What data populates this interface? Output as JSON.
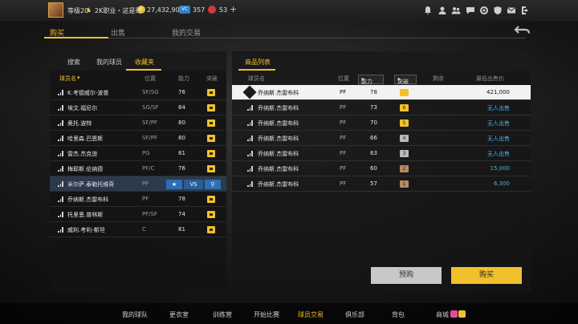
{
  "user": {
    "level": "等级20",
    "career": "2K职业・这是琦",
    "coins": "27,432,903",
    "vc": "357",
    "tickets": "53",
    "plus_symbol": "+"
  },
  "top_icons": [
    "bell-icon",
    "user-icon",
    "friends-icon",
    "chat-icon",
    "settings-icon",
    "shield-icon",
    "mail-icon",
    "exit-icon"
  ],
  "main_tabs": [
    {
      "label": "购买",
      "active": true
    },
    {
      "label": "出售",
      "active": false
    },
    {
      "label": "我的交易",
      "active": false
    }
  ],
  "left": {
    "sub_tabs": [
      "搜索",
      "我的球员",
      "收藏夹"
    ],
    "headers": {
      "name": "球员名",
      "position": "位置",
      "ability": "能力",
      "breakthrough": "突破"
    },
    "rows": [
      {
        "name": "K.考德威尔-波普",
        "pos": "SF/SG",
        "ovr": "76"
      },
      {
        "name": "埃文.福尼尔",
        "pos": "SG/SF",
        "ovr": "84"
      },
      {
        "name": "奥托.波特",
        "pos": "SF/PF",
        "ovr": "80"
      },
      {
        "name": "哈里森.巴恩斯",
        "pos": "SF/PF",
        "ovr": "80"
      },
      {
        "name": "雷杰.杰克逊",
        "pos": "PG",
        "ovr": "81"
      },
      {
        "name": "梅耶斯.伦纳德",
        "pos": "PF/C",
        "ovr": "76"
      },
      {
        "name": "米尔萨.泰勒托维奇",
        "pos": "PF",
        "ovr": ""
      },
      {
        "name": "乔纳斯.杰雷布科",
        "pos": "PF",
        "ovr": "78"
      },
      {
        "name": "托里恩.普林斯",
        "pos": "PF/SF",
        "ovr": "74"
      },
      {
        "name": "威利.考利-斯坦",
        "pos": "C",
        "ovr": "81"
      }
    ],
    "actions": {
      "favorite_label": "★",
      "compare_label": "VS",
      "search_label": "⚲"
    }
  },
  "right": {
    "title": "商品列表",
    "headers": {
      "name": "球员名",
      "position": "位置",
      "ability": "能力",
      "breakthrough": "突破",
      "remaining": "剩余",
      "price": "最低出售价"
    },
    "rows": [
      {
        "name": "乔纳斯.杰雷布科",
        "pos": "PF",
        "ovr": "78",
        "badge": "",
        "badge_color": "#f1c12c",
        "price": "421,000",
        "selected": true
      },
      {
        "name": "乔纳斯.杰雷布科",
        "pos": "PF",
        "ovr": "73",
        "badge": "6",
        "badge_color": "#f1c12c",
        "price": "无人出售",
        "selected": false
      },
      {
        "name": "乔纳斯.杰雷布科",
        "pos": "PF",
        "ovr": "70",
        "badge": "5",
        "badge_color": "#f1c12c",
        "price": "无人出售",
        "selected": false
      },
      {
        "name": "乔纳斯.杰雷布科",
        "pos": "PF",
        "ovr": "66",
        "badge": "4",
        "badge_color": "#b9b9b9",
        "price": "无人出售",
        "selected": false
      },
      {
        "name": "乔纳斯.杰雷布科",
        "pos": "PF",
        "ovr": "63",
        "badge": "3",
        "badge_color": "#b9b9b9",
        "price": "无人出售",
        "selected": false
      },
      {
        "name": "乔纳斯.杰雷布科",
        "pos": "PF",
        "ovr": "60",
        "badge": "2",
        "badge_color": "#b58962",
        "price": "15,000",
        "selected": false
      },
      {
        "name": "乔纳斯.杰雷布科",
        "pos": "PF",
        "ovr": "57",
        "badge": "1",
        "badge_color": "#b58962",
        "price": "6,300",
        "selected": false
      }
    ]
  },
  "buttons": {
    "preorder": "预购",
    "buy": "购买"
  },
  "bottom_nav": [
    {
      "label": "我的球队",
      "active": false
    },
    {
      "label": "更衣室",
      "active": false
    },
    {
      "label": "训练营",
      "active": false
    },
    {
      "label": "开始比赛",
      "active": false
    },
    {
      "label": "球员交易",
      "active": true
    },
    {
      "label": "俱乐部",
      "active": false
    },
    {
      "label": "背包",
      "active": false
    },
    {
      "label": "商城",
      "active": false
    }
  ],
  "colors": {
    "accent": "#f1c12c",
    "price_blue": "#4ab0e8",
    "highlight_row": "#2c3a4e"
  }
}
